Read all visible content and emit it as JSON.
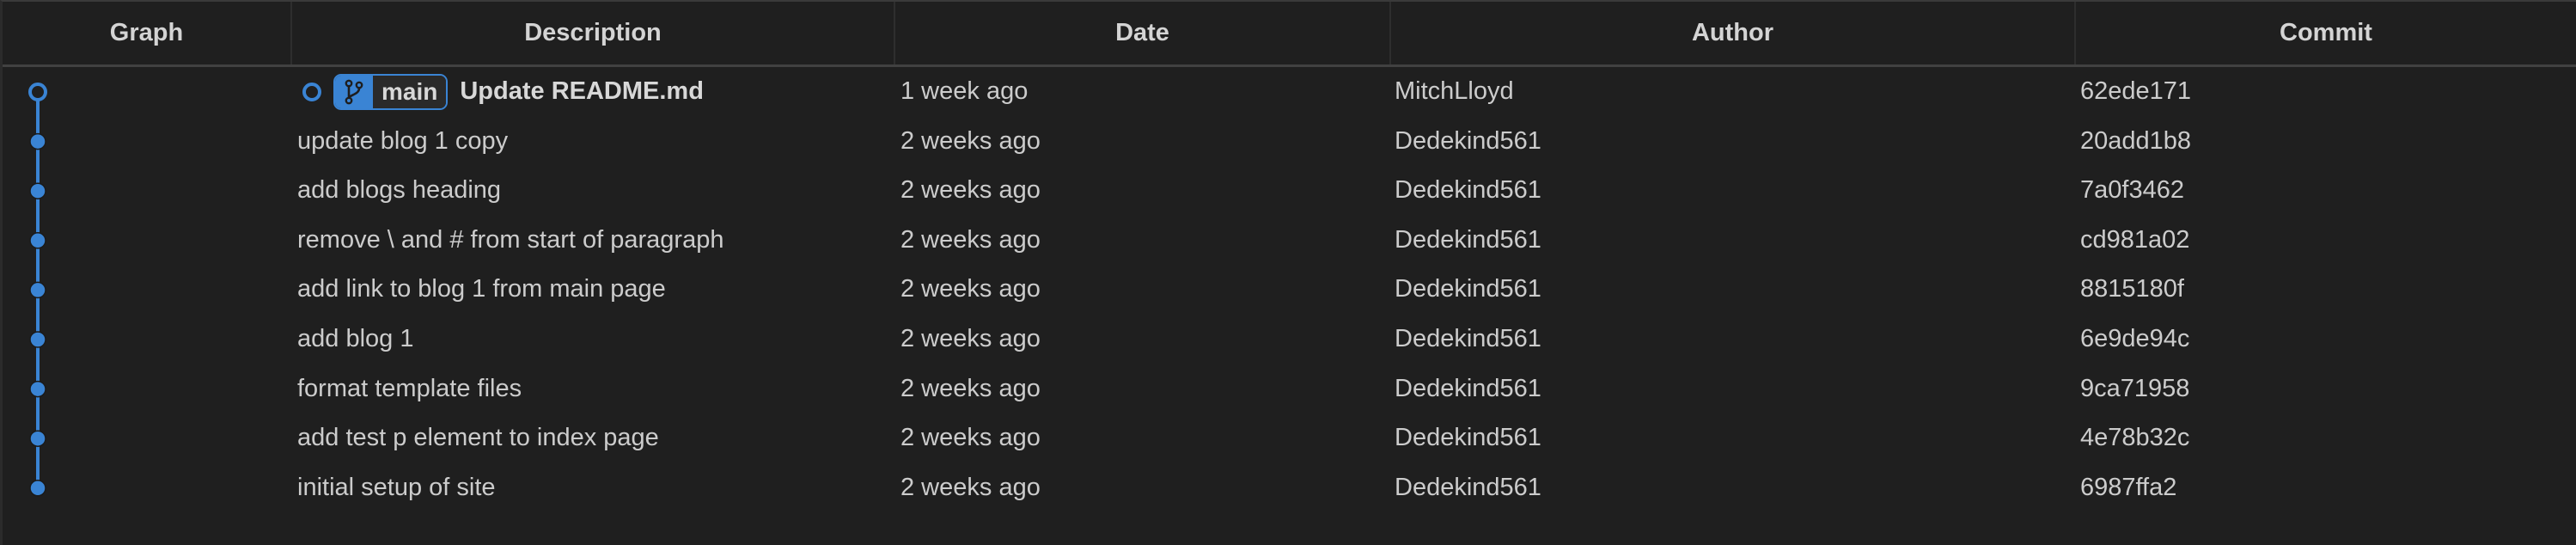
{
  "columns": [
    {
      "key": "graph",
      "label": "Graph"
    },
    {
      "key": "description",
      "label": "Description"
    },
    {
      "key": "date",
      "label": "Date"
    },
    {
      "key": "author",
      "label": "Author"
    },
    {
      "key": "commit",
      "label": "Commit"
    }
  ],
  "graph_color": "#3a84d4",
  "commits": [
    {
      "description": "Update README.md",
      "date": "1 week ago",
      "author": "MitchLloyd",
      "commit": "62ede171",
      "is_head": true,
      "branch": {
        "name": "main",
        "icon": "git-branch-icon"
      }
    },
    {
      "description": "update blog 1 copy",
      "date": "2 weeks ago",
      "author": "Dedekind561",
      "commit": "20add1b8",
      "is_head": false
    },
    {
      "description": "add blogs heading",
      "date": "2 weeks ago",
      "author": "Dedekind561",
      "commit": "7a0f3462",
      "is_head": false
    },
    {
      "description": "remove \\ and # from start of paragraph",
      "date": "2 weeks ago",
      "author": "Dedekind561",
      "commit": "cd981a02",
      "is_head": false
    },
    {
      "description": "add link to blog 1 from main page",
      "date": "2 weeks ago",
      "author": "Dedekind561",
      "commit": "8815180f",
      "is_head": false
    },
    {
      "description": "add blog 1",
      "date": "2 weeks ago",
      "author": "Dedekind561",
      "commit": "6e9de94c",
      "is_head": false
    },
    {
      "description": "format template files",
      "date": "2 weeks ago",
      "author": "Dedekind561",
      "commit": "9ca71958",
      "is_head": false
    },
    {
      "description": "add test p element to index page",
      "date": "2 weeks ago",
      "author": "Dedekind561",
      "commit": "4e78b32c",
      "is_head": false
    },
    {
      "description": "initial setup of site",
      "date": "2 weeks ago",
      "author": "Dedekind561",
      "commit": "6987ffa2",
      "is_head": false
    }
  ]
}
